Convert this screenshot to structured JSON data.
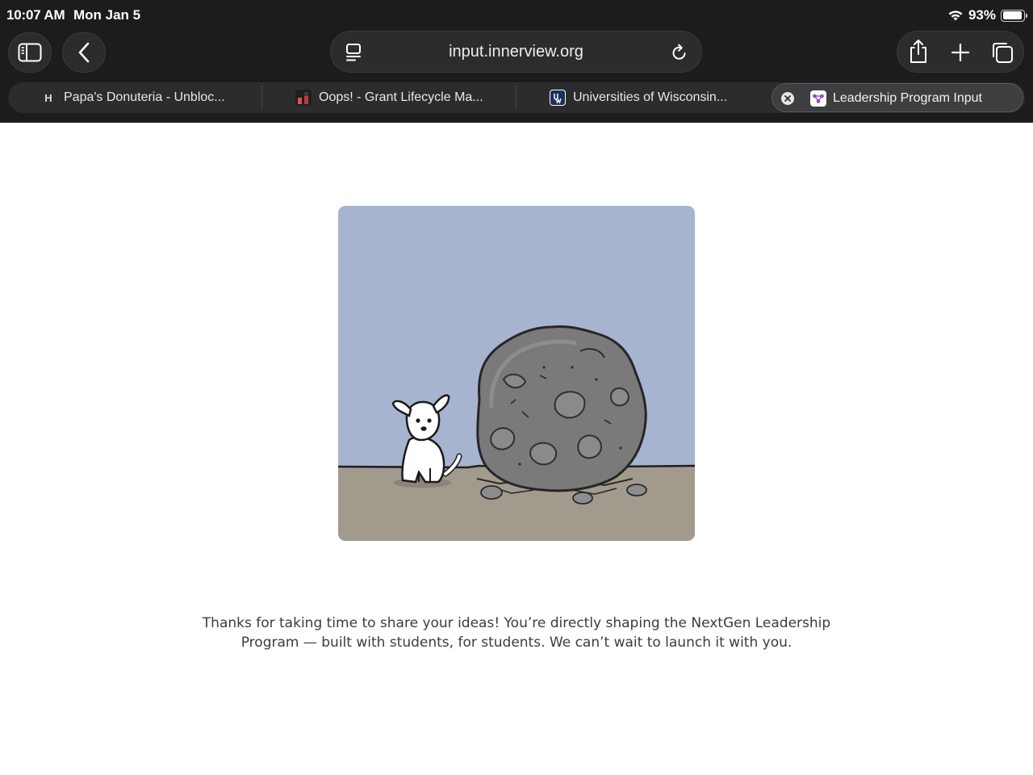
{
  "status_bar": {
    "time": "10:07 AM",
    "date": "Mon Jan 5",
    "battery": "93%",
    "battery_level": 0.93
  },
  "toolbar": {
    "url": "input.innerview.org"
  },
  "tabs": [
    {
      "title": "Papa's Donuteria - Unbloc...",
      "favicon": "H"
    },
    {
      "title": "Oops! - Grant Lifecycle Ma..."
    },
    {
      "title": "Universities of Wisconsin..."
    },
    {
      "title": "Leadership Program Input",
      "active": true
    }
  ],
  "content": {
    "message_line_1": "Thanks for taking  time to share your ideas! You’re directly shaping the NextGen Leadership",
    "message_line_2": "Program — built with students, for students. We can’t wait to launch it with you."
  },
  "colors": {
    "chrome_bg": "#1c1c1e",
    "sky": "#a7b4d0",
    "ground": "#a39a8e",
    "boulder": "#7a7a7a"
  }
}
